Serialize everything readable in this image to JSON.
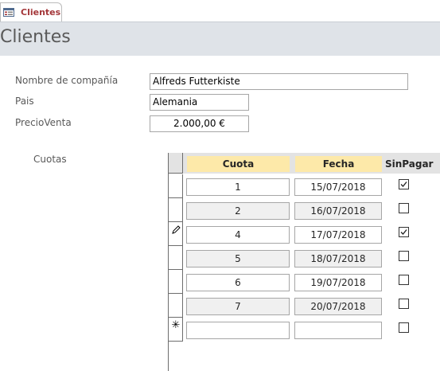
{
  "tab": {
    "label": "Clientes",
    "icon": "form-icon"
  },
  "header": {
    "title": "Clientes"
  },
  "form": {
    "company_label": "Nombre de compañía",
    "company_value": "Alfreds Futterkiste",
    "country_label": "Pais",
    "country_value": "Alemania",
    "price_label": "PrecioVenta",
    "price_value": "2.000,00 €",
    "subform_label": "Cuotas"
  },
  "subform": {
    "columns": [
      "Cuota",
      "Fecha",
      "SinPagar"
    ],
    "rows": [
      {
        "cuota": "1",
        "fecha": "15/07/2018",
        "sinpagar": true,
        "selector": ""
      },
      {
        "cuota": "2",
        "fecha": "16/07/2018",
        "sinpagar": false,
        "selector": ""
      },
      {
        "cuota": "4",
        "fecha": "17/07/2018",
        "sinpagar": true,
        "selector": "pencil"
      },
      {
        "cuota": "5",
        "fecha": "18/07/2018",
        "sinpagar": false,
        "selector": ""
      },
      {
        "cuota": "6",
        "fecha": "19/07/2018",
        "sinpagar": false,
        "selector": ""
      },
      {
        "cuota": "7",
        "fecha": "20/07/2018",
        "sinpagar": false,
        "selector": ""
      }
    ],
    "new_row_symbol": "✳"
  }
}
